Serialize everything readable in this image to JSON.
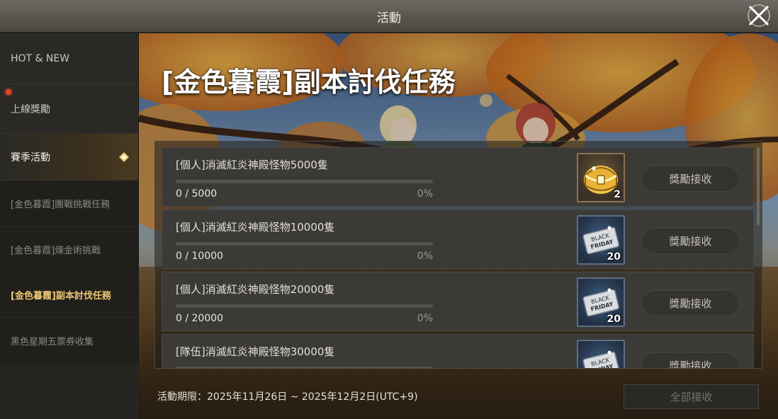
{
  "window": {
    "title": "活動"
  },
  "sidebar": {
    "items": [
      {
        "label": "HOT & NEW",
        "kind": "major"
      },
      {
        "label": "上線獎勵",
        "kind": "major",
        "badge": true
      },
      {
        "label": "賽季活動",
        "kind": "major",
        "active": true
      },
      {
        "label": "[金色暮霞]團戰挑戰任務",
        "kind": "sub"
      },
      {
        "label": "[金色暮霞]煉金術挑戰",
        "kind": "sub"
      },
      {
        "label": "[金色暮霞]副本討伐任務",
        "kind": "sub",
        "active": true
      },
      {
        "label": "黑色星期五票券收集",
        "kind": "sub"
      }
    ]
  },
  "main": {
    "event_title": "[金色暮霞]副本討伐任務",
    "missions": [
      {
        "name": "[個人]消滅紅炎神殿怪物5000隻",
        "count": "0 / 5000",
        "percent": "0%",
        "progress": 0,
        "reward_icon": "golden-chest-icon",
        "reward_qty": "2",
        "claim_label": "獎勵接收"
      },
      {
        "name": "[個人]消滅紅炎神殿怪物10000隻",
        "count": "0 / 10000",
        "percent": "0%",
        "progress": 0,
        "reward_icon": "black-friday-ticket-icon",
        "reward_qty": "20",
        "claim_label": "獎勵接收"
      },
      {
        "name": "[個人]消滅紅炎神殿怪物20000隻",
        "count": "0 / 20000",
        "percent": "0%",
        "progress": 0,
        "reward_icon": "black-friday-ticket-icon",
        "reward_qty": "20",
        "claim_label": "獎勵接收"
      },
      {
        "name": "[隊伍]消滅紅炎神殿怪物30000隻",
        "count": "",
        "percent": "",
        "progress": 0,
        "reward_icon": "black-friday-ticket-icon",
        "reward_qty": "",
        "claim_label": "獎勵接收"
      }
    ],
    "ticket_text": [
      "BLACK",
      "FRIDAY"
    ],
    "period": "活動期限：2025年11月26日 ~ 2025年12月2日(UTC+9)",
    "claim_all_label": "全部接收"
  },
  "colors": {
    "accent_gold": "#f0c870",
    "progress_fill": "#d9b35a",
    "badge_red": "#e8402a"
  }
}
